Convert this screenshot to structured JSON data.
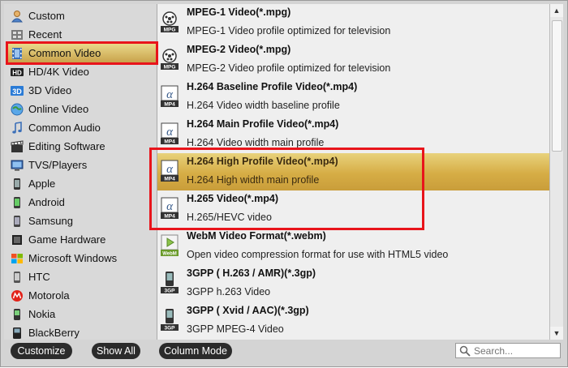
{
  "categories": [
    {
      "label": "Custom",
      "icon": "user-icon"
    },
    {
      "label": "Recent",
      "icon": "recent-icon"
    },
    {
      "label": "Common Video",
      "icon": "film-icon",
      "selected": true
    },
    {
      "label": "HD/4K Video",
      "icon": "hd-icon"
    },
    {
      "label": "3D Video",
      "icon": "3d-icon"
    },
    {
      "label": "Online Video",
      "icon": "globe-icon"
    },
    {
      "label": "Common Audio",
      "icon": "music-note-icon"
    },
    {
      "label": "Editing Software",
      "icon": "clapperboard-icon"
    },
    {
      "label": "TVS/Players",
      "icon": "tv-icon"
    },
    {
      "label": "Apple",
      "icon": "phone-icon"
    },
    {
      "label": "Android",
      "icon": "android-icon"
    },
    {
      "label": "Samsung",
      "icon": "samsung-icon"
    },
    {
      "label": "Game Hardware",
      "icon": "game-icon"
    },
    {
      "label": "Microsoft Windows",
      "icon": "windows-icon"
    },
    {
      "label": "HTC",
      "icon": "htc-icon"
    },
    {
      "label": "Motorola",
      "icon": "motorola-icon"
    },
    {
      "label": "Nokia",
      "icon": "nokia-icon"
    },
    {
      "label": "BlackBerry",
      "icon": "blackberry-icon"
    }
  ],
  "formats": [
    {
      "name": "MPEG-1 Video(*.mpg)",
      "desc": "MPEG-1 Video profile optimized for television",
      "badge": "MPG"
    },
    {
      "name": "MPEG-2 Video(*.mpg)",
      "desc": "MPEG-2 Video profile optimized for television",
      "badge": "MPG"
    },
    {
      "name": "H.264 Baseline Profile Video(*.mp4)",
      "desc": "H.264 Video width baseline profile",
      "badge": "MP4"
    },
    {
      "name": "H.264 Main Profile Video(*.mp4)",
      "desc": "H.264 Video width main profile",
      "badge": "MP4"
    },
    {
      "name": "H.264 High Profile Video(*.mp4)",
      "desc": "H.264 High width main profile",
      "badge": "MP4",
      "selected": true
    },
    {
      "name": "H.265 Video(*.mp4)",
      "desc": "H.265/HEVC video",
      "badge": "MP4"
    },
    {
      "name": "WebM Video Format(*.webm)",
      "desc": "Open video compression format for use with HTML5 video",
      "badge": "WebM"
    },
    {
      "name": "3GPP ( H.263 / AMR)(*.3gp)",
      "desc": "3GPP h.263 Video",
      "badge": "3GP"
    },
    {
      "name": "3GPP ( Xvid / AAC)(*.3gp)",
      "desc": "3GPP MPEG-4 Video",
      "badge": "3GP"
    }
  ],
  "buttons": {
    "customize": "Customize",
    "show_all": "Show All",
    "column_mode": "Column Mode"
  },
  "search": {
    "placeholder": "Search..."
  },
  "colors": {
    "highlight_box": "#e8141b",
    "selected_gradient_top": "#e8d27c",
    "selected_gradient_bottom": "#c99d3a"
  }
}
